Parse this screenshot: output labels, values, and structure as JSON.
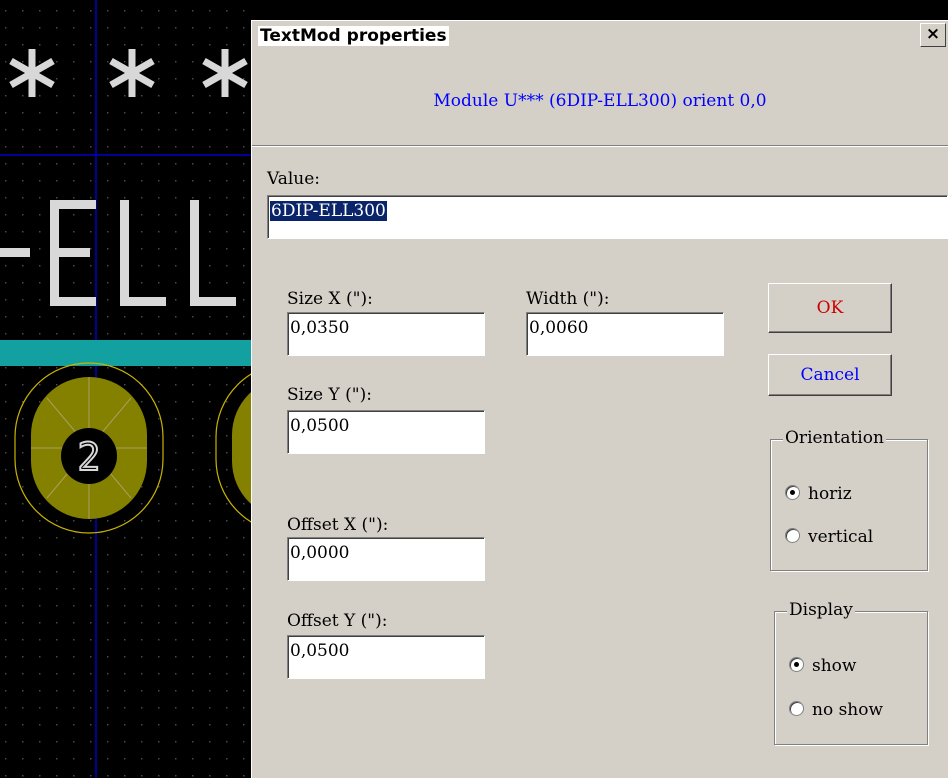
{
  "pcb": {
    "asterisk_text": "***",
    "ref_text": "ELL",
    "pad_number": "2",
    "colors": {
      "background": "#000000",
      "grid": "#4a4a4a",
      "axis": "#0000c8",
      "silkscreen": "#d8d8d8",
      "copper": "#848000",
      "teal": "#12a0a0"
    }
  },
  "dialog": {
    "title": "TextMod properties",
    "close_label": "×",
    "header": "Module U*** (6DIP-ELL300) orient 0,0",
    "value_label": "Value:",
    "value": "6DIP-ELL300",
    "size_x_label": "Size X (\"):",
    "size_x": "0,0350",
    "width_label": "Width (\"):",
    "width": "0,0060",
    "size_y_label": "Size Y (\"):",
    "size_y": "0,0500",
    "offset_x_label": "Offset X (\"):",
    "offset_x": "0,0000",
    "offset_y_label": "Offset Y (\"):",
    "offset_y": "0,0500",
    "ok_label": "OK",
    "cancel_label": "Cancel",
    "orientation": {
      "title": "Orientation",
      "options": [
        "horiz",
        "vertical"
      ],
      "selected": "horiz"
    },
    "display": {
      "title": "Display",
      "options": [
        "show",
        "no show"
      ],
      "selected": "show"
    }
  }
}
